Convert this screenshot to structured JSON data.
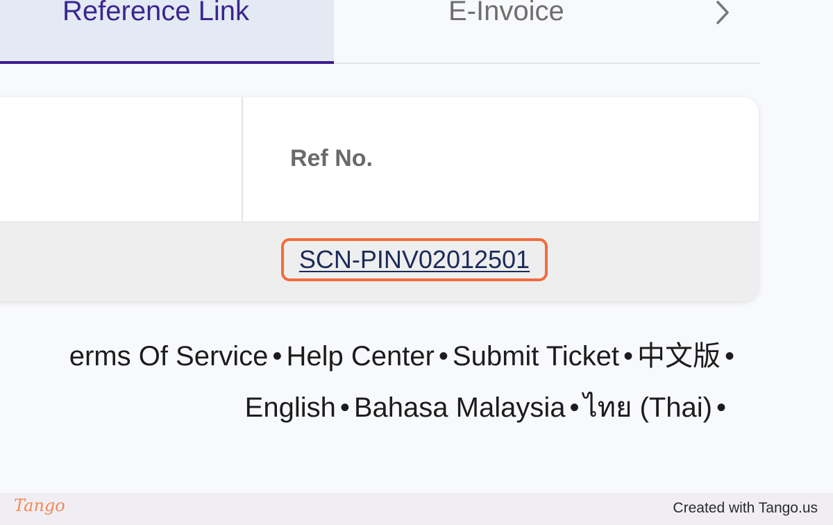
{
  "tabs": [
    {
      "label": "Reference Link",
      "active": true
    },
    {
      "label": "E-Invoice",
      "active": false
    }
  ],
  "tab_next_icon": "chevron-right-icon",
  "table": {
    "headers": [
      "",
      "Ref No."
    ],
    "rows": [
      {
        "ref_no": "SCN-PINV02012501"
      }
    ]
  },
  "footer": {
    "line1": [
      "erms Of Service",
      "Help Center",
      "Submit Ticket",
      "中文版"
    ],
    "line2": [
      "English",
      "Bahasa Malaysia",
      "ไทย (Thai)"
    ],
    "separator": "•"
  },
  "tango": {
    "logo": "Tango",
    "credit": "Created with Tango.us"
  },
  "colors": {
    "accent": "#3b1b8e",
    "highlight": "#f26b3a"
  }
}
